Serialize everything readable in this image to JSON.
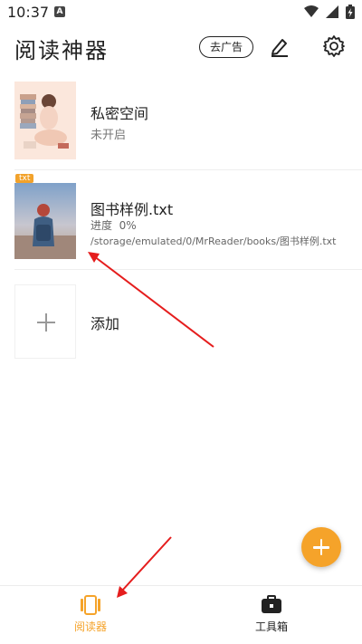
{
  "status_bar": {
    "time": "10:37",
    "notification_letter": "A"
  },
  "header": {
    "title": "阅读神器",
    "ad_button_label": "去广告",
    "icons": [
      "edit-icon",
      "settings-icon"
    ]
  },
  "books": [
    {
      "title": "私密空间",
      "status": "未开启",
      "cover": "illustrated-girl-reading"
    },
    {
      "badge": "txt",
      "title": "图书样例.txt",
      "progress": "进度  0%",
      "path": "/storage/emulated/0/MrReader/books/图书样例.txt",
      "cover": "girl-backpack-photo"
    }
  ],
  "add_item": {
    "label": "添加"
  },
  "fab": {
    "icon": "plus-icon",
    "color": "#f5a32a"
  },
  "bottom_nav": {
    "items": [
      {
        "label": "阅读器",
        "icon": "reader-icon",
        "active": true
      },
      {
        "label": "工具箱",
        "icon": "toolbox-icon",
        "active": false
      }
    ],
    "active_color": "#f5a32a"
  },
  "annotations": {
    "arrow_color": "#e51d1d"
  }
}
